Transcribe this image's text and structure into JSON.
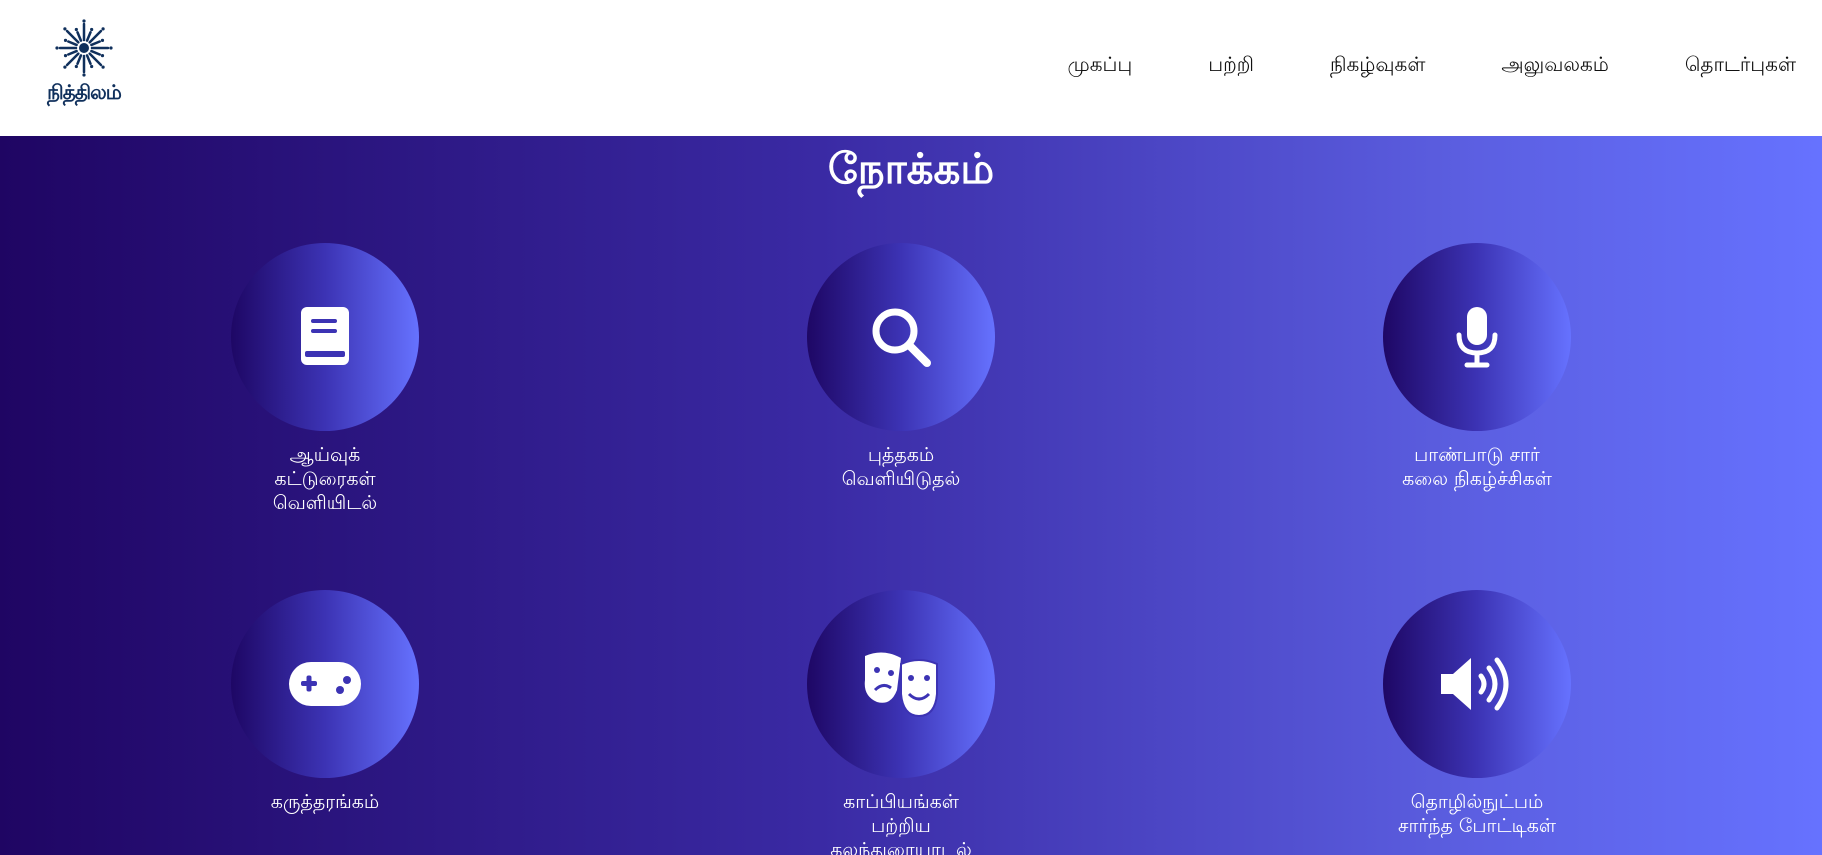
{
  "header": {
    "logo": {
      "text": "நித்திலம்",
      "icon": "sunburst-logo-icon"
    },
    "nav": [
      {
        "label": "முகப்பு"
      },
      {
        "label": "பற்றி"
      },
      {
        "label": "நிகழ்வுகள்"
      },
      {
        "label": "அலுவலகம்"
      },
      {
        "label": "தொடர்புகள்"
      }
    ]
  },
  "hero": {
    "title": "நோக்கம்",
    "features": [
      {
        "label": "ஆய்வுக்\nகட்டுரைகள்\nவெளியிடல்",
        "icon": "book-icon"
      },
      {
        "label": "புத்தகம்\nவெளியிடுதல்",
        "icon": "search-icon"
      },
      {
        "label": "பாண்பாடு சார்\nகலை நிகழ்ச்சிகள்",
        "icon": "microphone-icon"
      },
      {
        "label": "கருத்தரங்கம்",
        "icon": "gamepad-icon"
      },
      {
        "label": "காப்பியங்கள்\nபற்றிய\nகலந்துரையாடல்",
        "icon": "theater-masks-icon"
      },
      {
        "label": "தொழில்நுட்பம்\nசார்ந்த போட்டிகள்",
        "icon": "speaker-volume-icon"
      }
    ]
  },
  "colors": {
    "gradient_start": "#1f0563",
    "gradient_end": "#6672ff",
    "logo": "#10305c"
  }
}
